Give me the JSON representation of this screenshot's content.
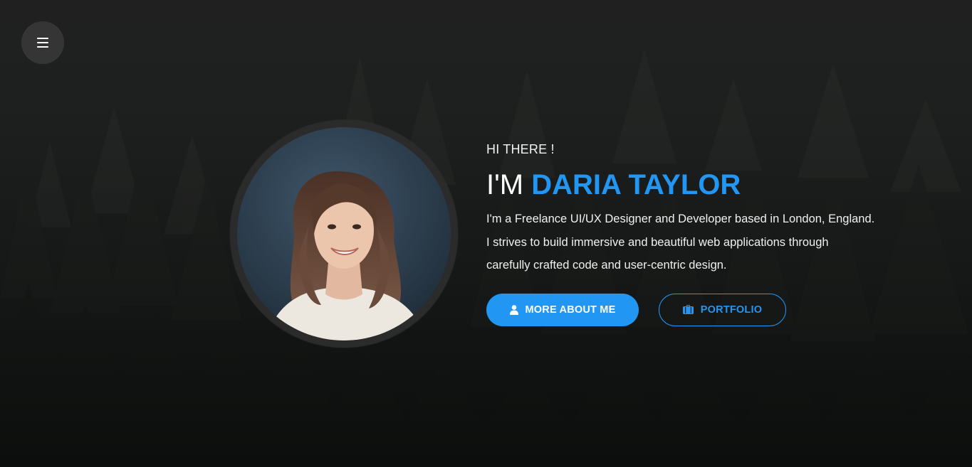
{
  "nav": {
    "menu_icon": "hamburger-icon"
  },
  "hero": {
    "greeting": "HI THERE !",
    "headline_prefix": "I'M ",
    "headline_name": "DARIA TAYLOR",
    "bio_lines": [
      "I'm a Freelance UI/UX Designer and Developer based in London, England.",
      "I strives to build immersive and beautiful web applications through",
      "carefully crafted code and user-centric design."
    ],
    "buttons": {
      "about": {
        "label": "MORE ABOUT ME",
        "icon": "user-icon"
      },
      "portfolio": {
        "label": "PORTFOLIO",
        "icon": "briefcase-icon"
      }
    }
  },
  "colors": {
    "accent": "#2196f3",
    "background": "#1b1b1b",
    "menu_button": "#353535",
    "text": "#ffffff"
  }
}
